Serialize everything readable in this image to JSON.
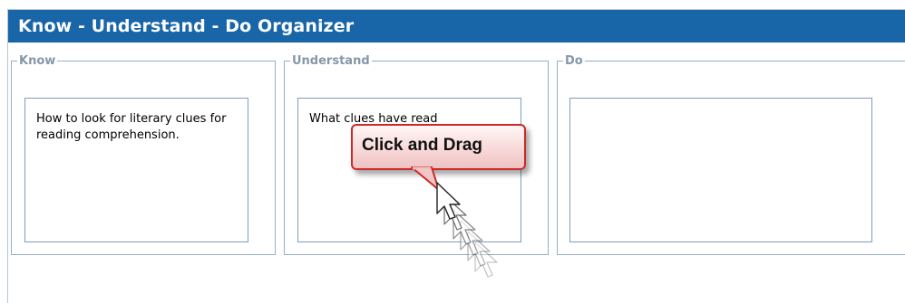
{
  "window": {
    "title": "Know - Understand - Do Organizer"
  },
  "sections": [
    {
      "legend": "Know",
      "text": "How to look for literary clues for reading comprehension."
    },
    {
      "legend": "Understand",
      "text": "What clues have read"
    },
    {
      "legend": "Do",
      "text": ""
    }
  ],
  "tooltip": {
    "label": "Click and Drag"
  },
  "colors": {
    "title_bar": "#1866a8",
    "callout_border": "#cf2828",
    "legend_text": "#8597a9"
  },
  "icons": {
    "cursor": "arrow-cursor-icon"
  }
}
